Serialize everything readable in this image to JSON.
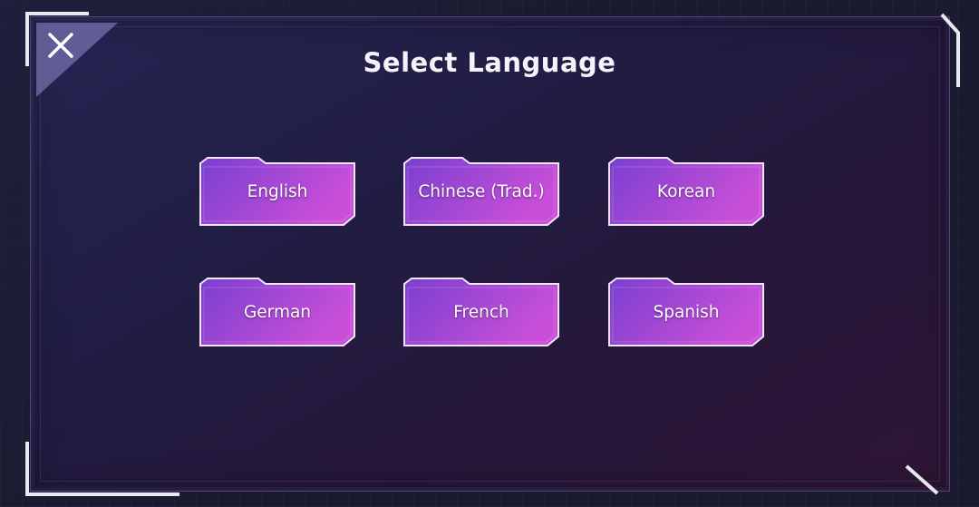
{
  "dialog": {
    "title": "Select Language",
    "close_icon": "close-icon"
  },
  "languages": [
    {
      "label": "English"
    },
    {
      "label": "Chinese (Trad.)"
    },
    {
      "label": "Korean"
    },
    {
      "label": "German"
    },
    {
      "label": "French"
    },
    {
      "label": "Spanish"
    }
  ],
  "colors": {
    "button_fill_start": "#7a3fd0",
    "button_fill_end": "#c94fd8",
    "button_border": "#f0e6ff",
    "panel_bg": "#221e46",
    "accent": "#e8e8f0"
  }
}
